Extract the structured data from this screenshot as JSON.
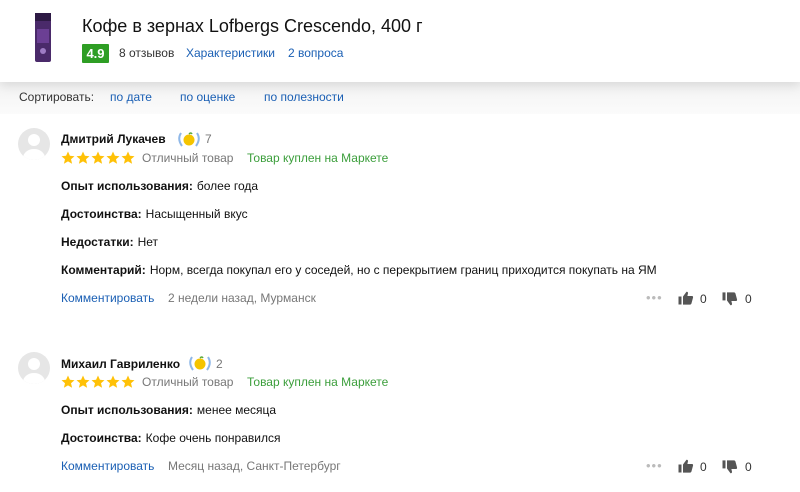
{
  "product": {
    "title": "Кофе в зернах Lofbergs Crescendo, 400 г",
    "rating": "4.9",
    "reviews": "8 отзывов",
    "specs_link": "Характеристики",
    "questions_link": "2 вопроса"
  },
  "sort": {
    "label": "Сортировать:",
    "options": [
      "по дате",
      "по оценке",
      "по полезности"
    ]
  },
  "reviews": [
    {
      "author": "Дмитрий Лукачев",
      "achievements": "7",
      "stars": 5,
      "verdict": "Отличный товар",
      "bought": "Товар куплен на Маркете",
      "fields": [
        {
          "label": "Опыт использования:",
          "value": "более года"
        },
        {
          "label": "Достоинства:",
          "value": "Насыщенный вкус"
        },
        {
          "label": "Недостатки:",
          "value": "Нет"
        },
        {
          "label": "Комментарий:",
          "value": "Норм, всегда покупал его у соседей, но с перекрытием границ приходится покупать на ЯМ"
        }
      ],
      "comment_link": "Комментировать",
      "meta": "2 недели назад, Мурманск",
      "likes": "0",
      "dislikes": "0"
    },
    {
      "author": "Михаил Гавриленко",
      "achievements": "2",
      "stars": 5,
      "verdict": "Отличный товар",
      "bought": "Товар куплен на Маркете",
      "fields": [
        {
          "label": "Опыт использования:",
          "value": "менее месяца"
        },
        {
          "label": "Достоинства:",
          "value": "Кофе очень понравился"
        }
      ],
      "comment_link": "Комментировать",
      "meta": "Месяц назад, Санкт-Петербург",
      "likes": "0",
      "dislikes": "0"
    }
  ],
  "icons": {
    "more": "more-dots-icon",
    "like": "thumbs-up-icon",
    "dislike": "thumbs-down-icon",
    "star": "star-icon",
    "achievement": "laurel-achievement-icon"
  },
  "colors": {
    "rating_badge": "#2e9e24",
    "link": "#1a5fb4",
    "star": "#ffc107",
    "bought": "#3b9e3b"
  }
}
